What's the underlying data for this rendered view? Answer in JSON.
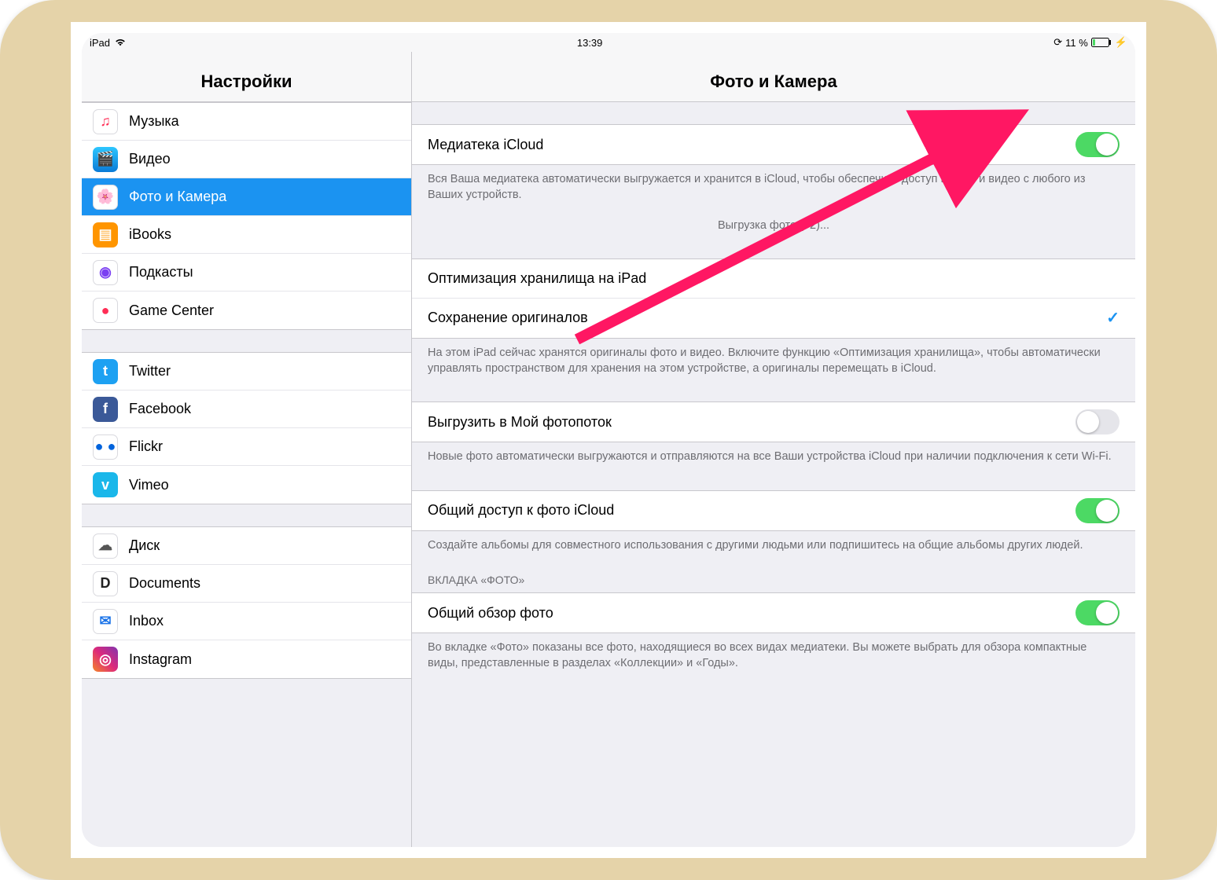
{
  "status": {
    "device_label": "iPad",
    "time": "13:39",
    "battery_text": "11 %"
  },
  "left": {
    "title": "Настройки",
    "groups": [
      {
        "items": [
          {
            "name": "music",
            "label": "Музыка",
            "icon_bg": "#ffffff",
            "icon_glyph": "♫",
            "icon_color": "#ff2d55",
            "selected": false
          },
          {
            "name": "video",
            "label": "Видео",
            "icon_bg": "linear-gradient(180deg,#2ec7ff,#0a7ad6)",
            "icon_glyph": "🎬",
            "icon_color": "#fff",
            "selected": false
          },
          {
            "name": "photos-camera",
            "label": "Фото и Камера",
            "icon_bg": "#ffffff",
            "icon_glyph": "🌸",
            "icon_color": "#ff3b30",
            "selected": true
          },
          {
            "name": "ibooks",
            "label": "iBooks",
            "icon_bg": "#ff9500",
            "icon_glyph": "▤",
            "icon_color": "#fff",
            "selected": false
          },
          {
            "name": "podcasts",
            "label": "Подкасты",
            "icon_bg": "#ffffff",
            "icon_glyph": "◉",
            "icon_color": "#7b3ff2",
            "selected": false
          },
          {
            "name": "game-center",
            "label": "Game Center",
            "icon_bg": "#ffffff",
            "icon_glyph": "●",
            "icon_color": "#ff2d55",
            "selected": false
          }
        ]
      },
      {
        "items": [
          {
            "name": "twitter",
            "label": "Twitter",
            "icon_bg": "#1da1f2",
            "icon_glyph": "t",
            "icon_color": "#fff",
            "selected": false
          },
          {
            "name": "facebook",
            "label": "Facebook",
            "icon_bg": "#3b5998",
            "icon_glyph": "f",
            "icon_color": "#fff",
            "selected": false
          },
          {
            "name": "flickr",
            "label": "Flickr",
            "icon_bg": "#ffffff",
            "icon_glyph": "● ●",
            "icon_color": "#0063dc",
            "selected": false
          },
          {
            "name": "vimeo",
            "label": "Vimeo",
            "icon_bg": "#1ab7ea",
            "icon_glyph": "v",
            "icon_color": "#fff",
            "selected": false
          }
        ]
      },
      {
        "items": [
          {
            "name": "disk",
            "label": "Диск",
            "icon_bg": "#ffffff",
            "icon_glyph": "☁",
            "icon_color": "#555",
            "selected": false
          },
          {
            "name": "documents",
            "label": "Documents",
            "icon_bg": "#ffffff",
            "icon_glyph": "D",
            "icon_color": "#222",
            "selected": false
          },
          {
            "name": "inbox",
            "label": "Inbox",
            "icon_bg": "#ffffff",
            "icon_glyph": "✉",
            "icon_color": "#1a73e8",
            "selected": false
          },
          {
            "name": "instagram",
            "label": "Instagram",
            "icon_bg": "linear-gradient(45deg,#f58529,#dd2a7b,#8134af)",
            "icon_glyph": "◎",
            "icon_color": "#fff",
            "selected": false
          }
        ]
      }
    ]
  },
  "right": {
    "title": "Фото и Камера",
    "sections": [
      {
        "rows": [
          {
            "name": "icloud-library",
            "label": "Медиатека iCloud",
            "type": "toggle",
            "value": true
          }
        ],
        "footer": "Вся Ваша медиатека автоматически выгружается и хранится в iCloud, чтобы обеспечить доступ к фото и видео с любого из Ваших устройств.",
        "subfooter_center": "Выгрузка фото (72)..."
      },
      {
        "rows": [
          {
            "name": "optimize-storage",
            "label": "Оптимизация хранилища на iPad",
            "type": "radio",
            "value": false
          },
          {
            "name": "keep-originals",
            "label": "Сохранение оригиналов",
            "type": "radio",
            "value": true
          }
        ],
        "footer": "На этом iPad сейчас хранятся оригиналы фото и видео. Включите функцию «Оптимизация хранилища», чтобы автоматически управлять пространством для хранения на этом устройстве, а оригиналы перемещать в iCloud."
      },
      {
        "rows": [
          {
            "name": "my-photo-stream",
            "label": "Выгрузить в Мой фотопоток",
            "type": "toggle",
            "value": false
          }
        ],
        "footer": "Новые фото автоматически выгружаются и отправляются на все Ваши устройства iCloud при наличии подключения к сети Wi-Fi."
      },
      {
        "rows": [
          {
            "name": "icloud-photo-sharing",
            "label": "Общий доступ к фото iCloud",
            "type": "toggle",
            "value": true
          }
        ],
        "footer": "Создайте альбомы для совместного использования с другими людьми или подпишитесь на общие альбомы других людей."
      },
      {
        "header": "ВКЛАДКА «ФОТО»",
        "rows": [
          {
            "name": "summarize-photos",
            "label": "Общий обзор фото",
            "type": "toggle",
            "value": true
          }
        ],
        "footer": "Во вкладке «Фото» показаны все фото, находящиеся во всех видах медиатеки. Вы можете выбрать для обзора компактные виды, представленные в разделах «Коллекции» и «Годы»."
      }
    ]
  },
  "annotation": {
    "arrow_color": "#ff1763"
  }
}
